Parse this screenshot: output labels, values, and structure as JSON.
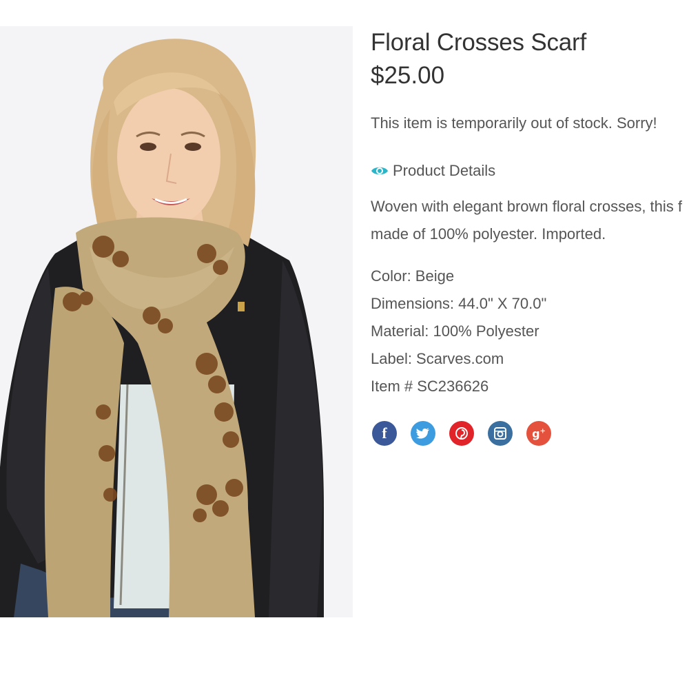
{
  "product": {
    "title": "Floral Crosses Scarf",
    "price": "$25.00",
    "stock_message": "This item is temporarily out of stock. Sorry!",
    "details_label": "Product Details",
    "description_line1": "Woven with elegant brown floral crosses, this f",
    "description_line2": "made of 100% polyester. Imported.",
    "specs": {
      "color": "Color: Beige",
      "dimensions": "Dimensions: 44.0\" X 70.0\"",
      "material": "Material: 100% Polyester",
      "label": "Label: Scarves.com",
      "item": "Item # SC236626"
    }
  },
  "social": [
    {
      "name": "facebook",
      "glyph": "f",
      "color": "#3b5998",
      "icon": "facebook-icon"
    },
    {
      "name": "twitter",
      "glyph": "🐦",
      "color": "#3d9be0",
      "icon": "twitter-icon"
    },
    {
      "name": "pinterest",
      "glyph": "℗",
      "color": "#e0242a",
      "icon": "pinterest-icon"
    },
    {
      "name": "instagram",
      "glyph": "◙",
      "color": "#3a6fa0",
      "icon": "instagram-icon"
    },
    {
      "name": "google-plus",
      "glyph": "g+",
      "color": "#e4513c",
      "icon": "google-plus-icon"
    }
  ],
  "colors": {
    "eye_icon": "#2bb5c8",
    "scarf": "#c2a97c",
    "scarf_print": "#7a4a22",
    "jacket": "#1f1f22"
  }
}
